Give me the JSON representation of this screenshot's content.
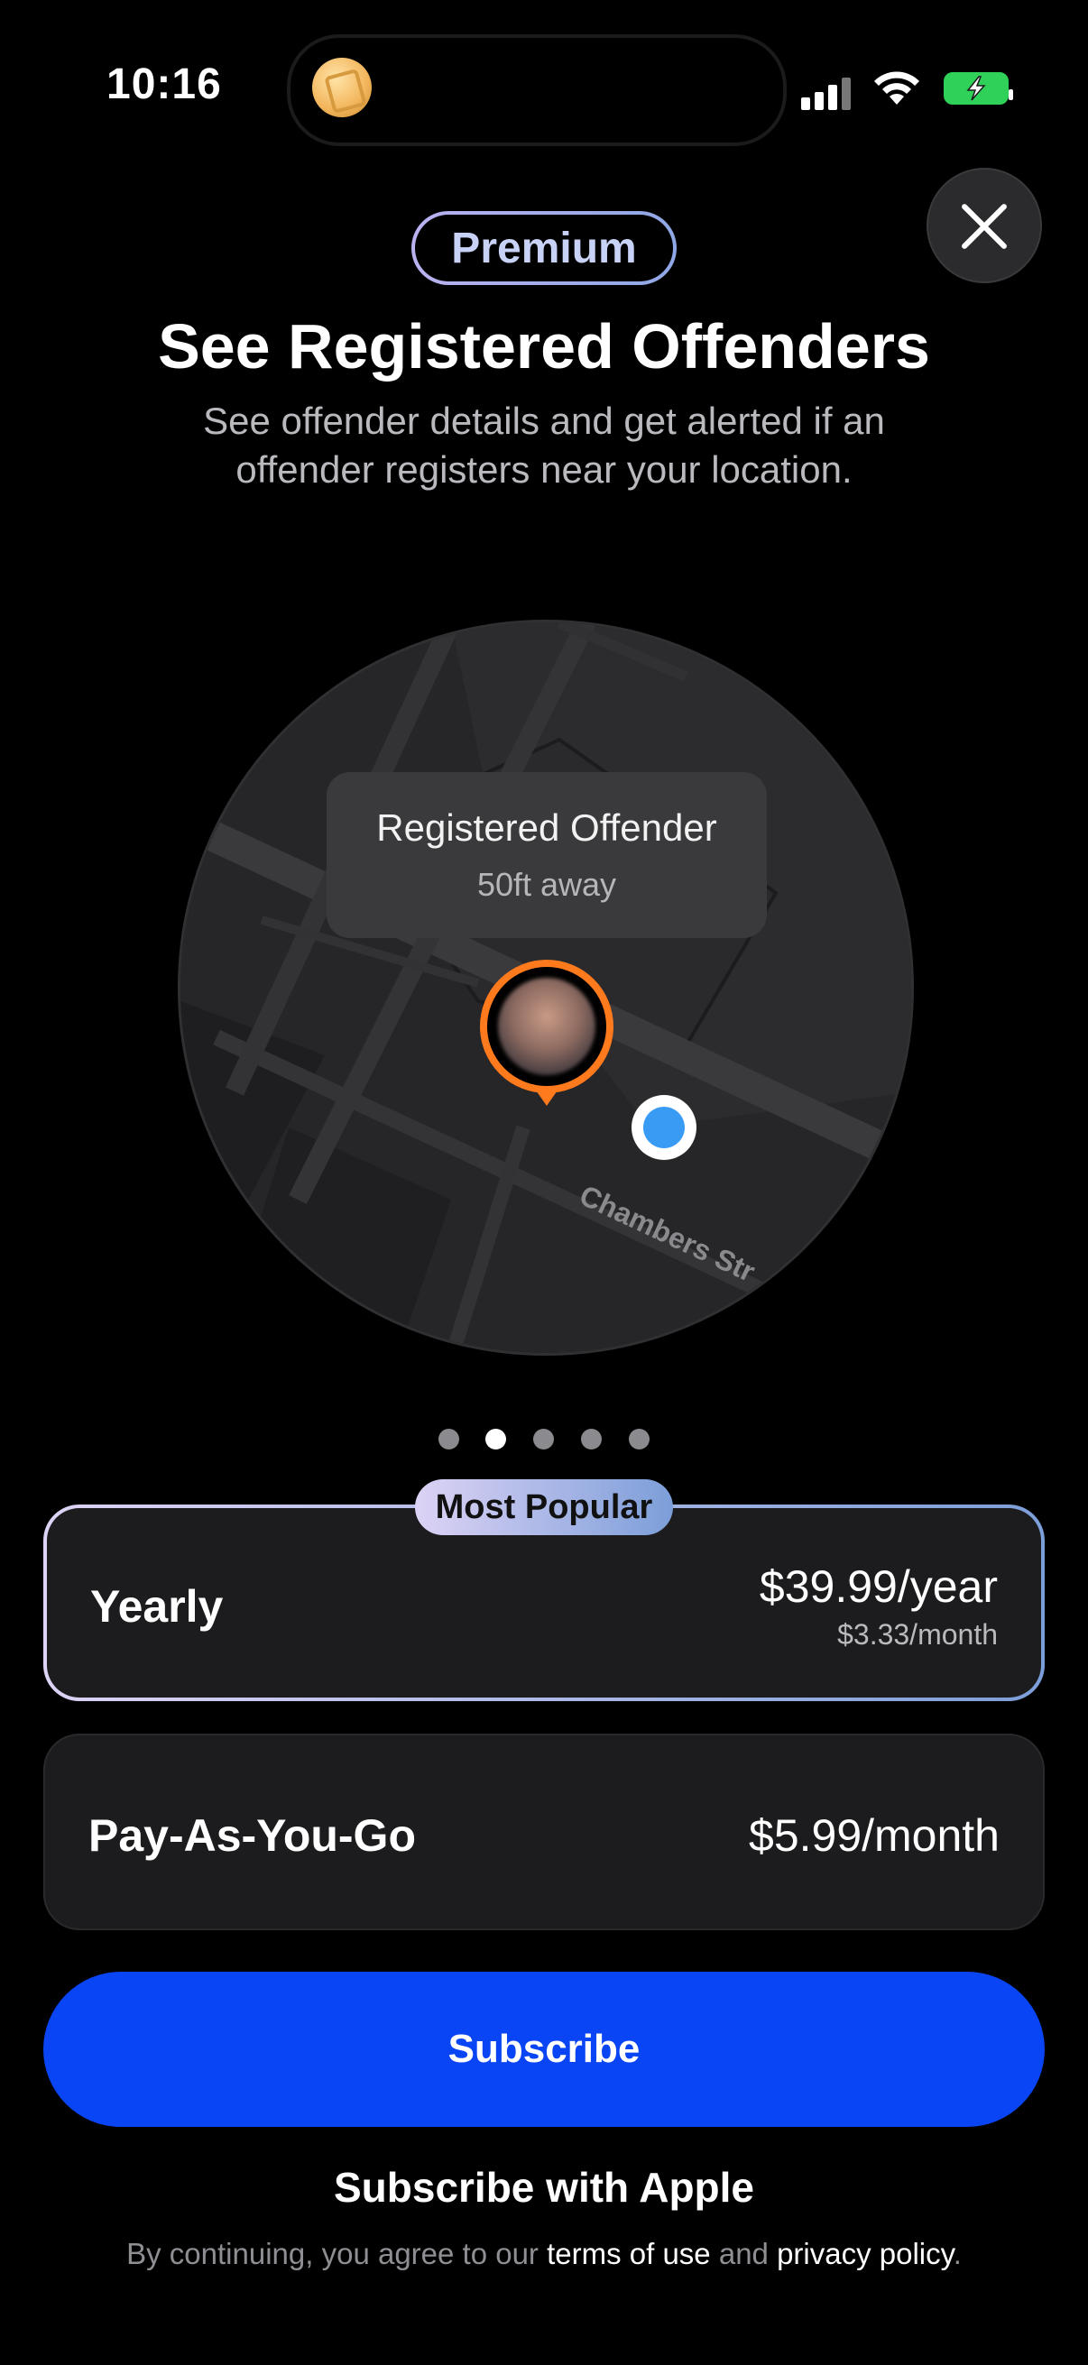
{
  "status_bar": {
    "time": "10:16",
    "icons": [
      "cellular-signal-icon",
      "wifi-icon",
      "battery-charging-icon",
      "live-activity-coin-icon"
    ]
  },
  "header": {
    "badge": "Premium",
    "title": "See Registered Offenders",
    "subtitle": "See offender details and get alerted if an offender registers near your location."
  },
  "map": {
    "tooltip_title": "Registered Offender",
    "tooltip_distance": "50ft away",
    "street_label": "Chambers Str"
  },
  "carousel": {
    "page_count": 5,
    "active_index": 1
  },
  "plans": {
    "popular_badge": "Most Popular",
    "yearly": {
      "name": "Yearly",
      "price": "$39.99/year",
      "per_month": "$3.33/month"
    },
    "payg": {
      "name": "Pay-As-You-Go",
      "price": "$5.99/month"
    }
  },
  "actions": {
    "subscribe": "Subscribe",
    "subscribe_apple": "Subscribe with Apple"
  },
  "legal": {
    "prefix": "By continuing, you agree to our ",
    "terms": "terms of use",
    "middle": " and ",
    "privacy": "privacy policy",
    "suffix": "."
  },
  "colors": {
    "accent_blue": "#0a45f5",
    "pin_orange": "#ff7a1c",
    "location_blue": "#3a9bf5",
    "premium_gradient_start": "#ddd3f5",
    "premium_gradient_end": "#7c9ed9"
  }
}
